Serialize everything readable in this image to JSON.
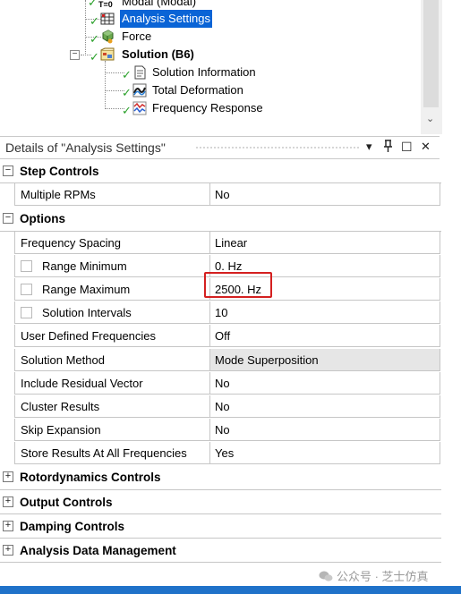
{
  "tree": {
    "items": [
      {
        "label": "Modal (Modal)",
        "prefix": "T=0"
      },
      {
        "label": "Analysis Settings"
      },
      {
        "label": "Force"
      },
      {
        "label": "Solution (B6)"
      },
      {
        "label": "Solution Information"
      },
      {
        "label": "Total Deformation"
      },
      {
        "label": "Frequency Response"
      }
    ],
    "collapse_glyph": "⊟"
  },
  "details": {
    "title": "Details of \"Analysis Settings\"",
    "buttons": {
      "dropdown": "▾",
      "pin": "ᚮ",
      "maximize": "☐",
      "close": "✕"
    },
    "sections": [
      {
        "label": "Step Controls",
        "toggle": "−",
        "rows": [
          {
            "name": "Multiple RPMs",
            "value": "No"
          }
        ]
      },
      {
        "label": "Options",
        "toggle": "−",
        "rows": [
          {
            "name": "Frequency Spacing",
            "value": "Linear"
          },
          {
            "name": "Range Minimum",
            "value": "0. Hz"
          },
          {
            "name": "Range Maximum",
            "value": "2500. Hz"
          },
          {
            "name": "Solution Intervals",
            "value": "10"
          },
          {
            "name": "User Defined Frequencies",
            "value": "Off"
          },
          {
            "name": "Solution Method",
            "value": "Mode Superposition"
          },
          {
            "name": "Include Residual Vector",
            "value": "No"
          },
          {
            "name": "Cluster Results",
            "value": "No"
          },
          {
            "name": "Skip Expansion",
            "value": "No"
          },
          {
            "name": "Store Results At All Frequencies",
            "value": "Yes"
          }
        ]
      },
      {
        "label": "Rotordynamics Controls",
        "toggle": "+"
      },
      {
        "label": "Output Controls",
        "toggle": "+"
      },
      {
        "label": "Damping Controls",
        "toggle": "+"
      },
      {
        "label": "Analysis Data Management",
        "toggle": "+"
      }
    ]
  },
  "watermark": {
    "text": "公众号 · 芝士仿真"
  },
  "colors": {
    "selection": "#0a64d6",
    "highlight": "#d42020",
    "bottom_bar": "#1f72c9",
    "check": "#2aa02a"
  }
}
